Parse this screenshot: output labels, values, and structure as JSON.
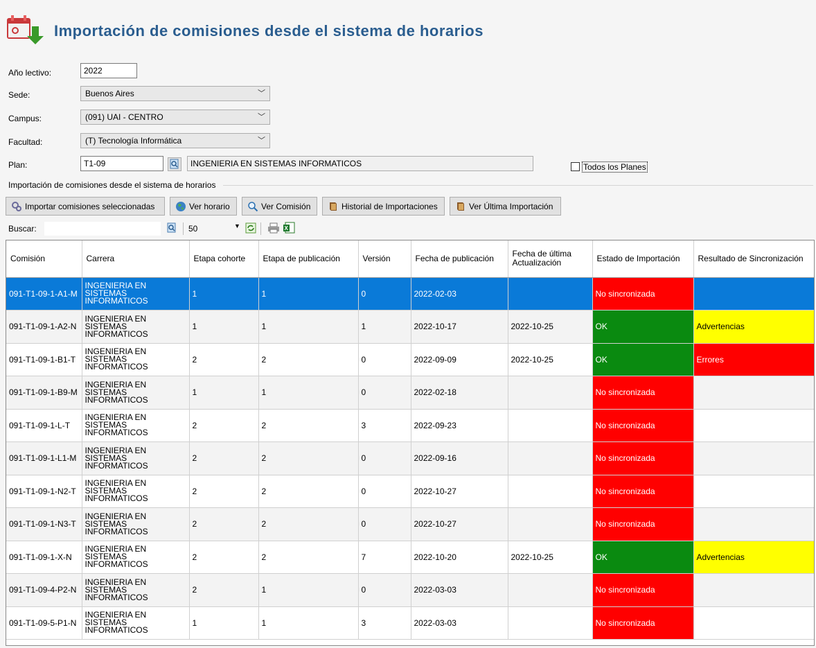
{
  "header": {
    "title": "Importación de comisiones desde el sistema de horarios"
  },
  "form": {
    "anio": {
      "label": "Año lectivo:",
      "value": "2022"
    },
    "sede": {
      "label": "Sede:",
      "value": "Buenos Aires"
    },
    "campus": {
      "label": "Campus:",
      "value": "(091) UAI - CENTRO"
    },
    "facultad": {
      "label": "Facultad:",
      "value": "(T) Tecnología Informática"
    },
    "plan": {
      "label": "Plan:",
      "code": "T1-09",
      "name": "INGENIERIA EN SISTEMAS INFORMATICOS"
    },
    "todos_planes": {
      "label": "Todos los Planes",
      "checked": false
    }
  },
  "group_title": "Importación de comisiones desde el sistema de horarios",
  "buttons": {
    "importar": "Importar comisiones seleccionadas",
    "ver_horario": "Ver horario",
    "ver_comision": "Ver Comisión",
    "historial": "Historial de Importaciones",
    "ultima": "Ver Última Importación"
  },
  "toolbar": {
    "search_label": "Buscar:",
    "search_value": "",
    "page_size": "50"
  },
  "columns": [
    "Comisión",
    "Carrera",
    "Etapa cohorte",
    "Etapa de publicación",
    "Versión",
    "Fecha de publicación",
    "Fecha de última Actualización",
    "Estado de Importación",
    "Resultado de Sincronización"
  ],
  "rows": [
    {
      "comision": "091-T1-09-1-A1-M",
      "carrera": "INGENIERIA EN SISTEMAS INFORMATICOS",
      "etapa_cohorte": "1",
      "etapa_pub": "1",
      "version": "0",
      "fecha_pub": "2022-02-03",
      "fecha_act": "",
      "estado": "No sincronizada",
      "resultado": ""
    },
    {
      "comision": "091-T1-09-1-A2-N",
      "carrera": "INGENIERIA EN SISTEMAS INFORMATICOS",
      "etapa_cohorte": "1",
      "etapa_pub": "1",
      "version": "1",
      "fecha_pub": "2022-10-17",
      "fecha_act": "2022-10-25",
      "estado": "OK",
      "resultado": "Advertencias"
    },
    {
      "comision": "091-T1-09-1-B1-T",
      "carrera": "INGENIERIA EN SISTEMAS INFORMATICOS",
      "etapa_cohorte": "2",
      "etapa_pub": "2",
      "version": "0",
      "fecha_pub": "2022-09-09",
      "fecha_act": "2022-10-25",
      "estado": "OK",
      "resultado": "Errores"
    },
    {
      "comision": "091-T1-09-1-B9-M",
      "carrera": "INGENIERIA EN SISTEMAS INFORMATICOS",
      "etapa_cohorte": "1",
      "etapa_pub": "1",
      "version": "0",
      "fecha_pub": "2022-02-18",
      "fecha_act": "",
      "estado": "No sincronizada",
      "resultado": ""
    },
    {
      "comision": "091-T1-09-1-L-T",
      "carrera": "INGENIERIA EN SISTEMAS INFORMATICOS",
      "etapa_cohorte": "2",
      "etapa_pub": "2",
      "version": "3",
      "fecha_pub": "2022-09-23",
      "fecha_act": "",
      "estado": "No sincronizada",
      "resultado": ""
    },
    {
      "comision": "091-T1-09-1-L1-M",
      "carrera": "INGENIERIA EN SISTEMAS INFORMATICOS",
      "etapa_cohorte": "2",
      "etapa_pub": "2",
      "version": "0",
      "fecha_pub": "2022-09-16",
      "fecha_act": "",
      "estado": "No sincronizada",
      "resultado": ""
    },
    {
      "comision": "091-T1-09-1-N2-T",
      "carrera": "INGENIERIA EN SISTEMAS INFORMATICOS",
      "etapa_cohorte": "2",
      "etapa_pub": "2",
      "version": "0",
      "fecha_pub": "2022-10-27",
      "fecha_act": "",
      "estado": "No sincronizada",
      "resultado": ""
    },
    {
      "comision": "091-T1-09-1-N3-T",
      "carrera": "INGENIERIA EN SISTEMAS INFORMATICOS",
      "etapa_cohorte": "2",
      "etapa_pub": "2",
      "version": "0",
      "fecha_pub": "2022-10-27",
      "fecha_act": "",
      "estado": "No sincronizada",
      "resultado": ""
    },
    {
      "comision": "091-T1-09-1-X-N",
      "carrera": "INGENIERIA EN SISTEMAS INFORMATICOS",
      "etapa_cohorte": "2",
      "etapa_pub": "2",
      "version": "7",
      "fecha_pub": "2022-10-20",
      "fecha_act": "2022-10-25",
      "estado": "OK",
      "resultado": "Advertencias"
    },
    {
      "comision": "091-T1-09-4-P2-N",
      "carrera": "INGENIERIA EN SISTEMAS INFORMATICOS",
      "etapa_cohorte": "2",
      "etapa_pub": "1",
      "version": "0",
      "fecha_pub": "2022-03-03",
      "fecha_act": "",
      "estado": "No sincronizada",
      "resultado": ""
    },
    {
      "comision": "091-T1-09-5-P1-N",
      "carrera": "INGENIERIA EN SISTEMAS INFORMATICOS",
      "etapa_cohorte": "1",
      "etapa_pub": "1",
      "version": "3",
      "fecha_pub": "2022-03-03",
      "fecha_act": "",
      "estado": "No sincronizada",
      "resultado": ""
    }
  ],
  "colors": {
    "selected": "#0a7ad8",
    "no_sync": "#ff0000",
    "ok": "#0a8a10",
    "warning": "#ffff00",
    "title": "#2a5d8f"
  },
  "icons": [
    "calendar-download-icon",
    "search-icon",
    "refresh-icon",
    "print-icon",
    "excel-icon",
    "gears-icon",
    "globe-icon",
    "magnifier-icon",
    "book-icon"
  ]
}
